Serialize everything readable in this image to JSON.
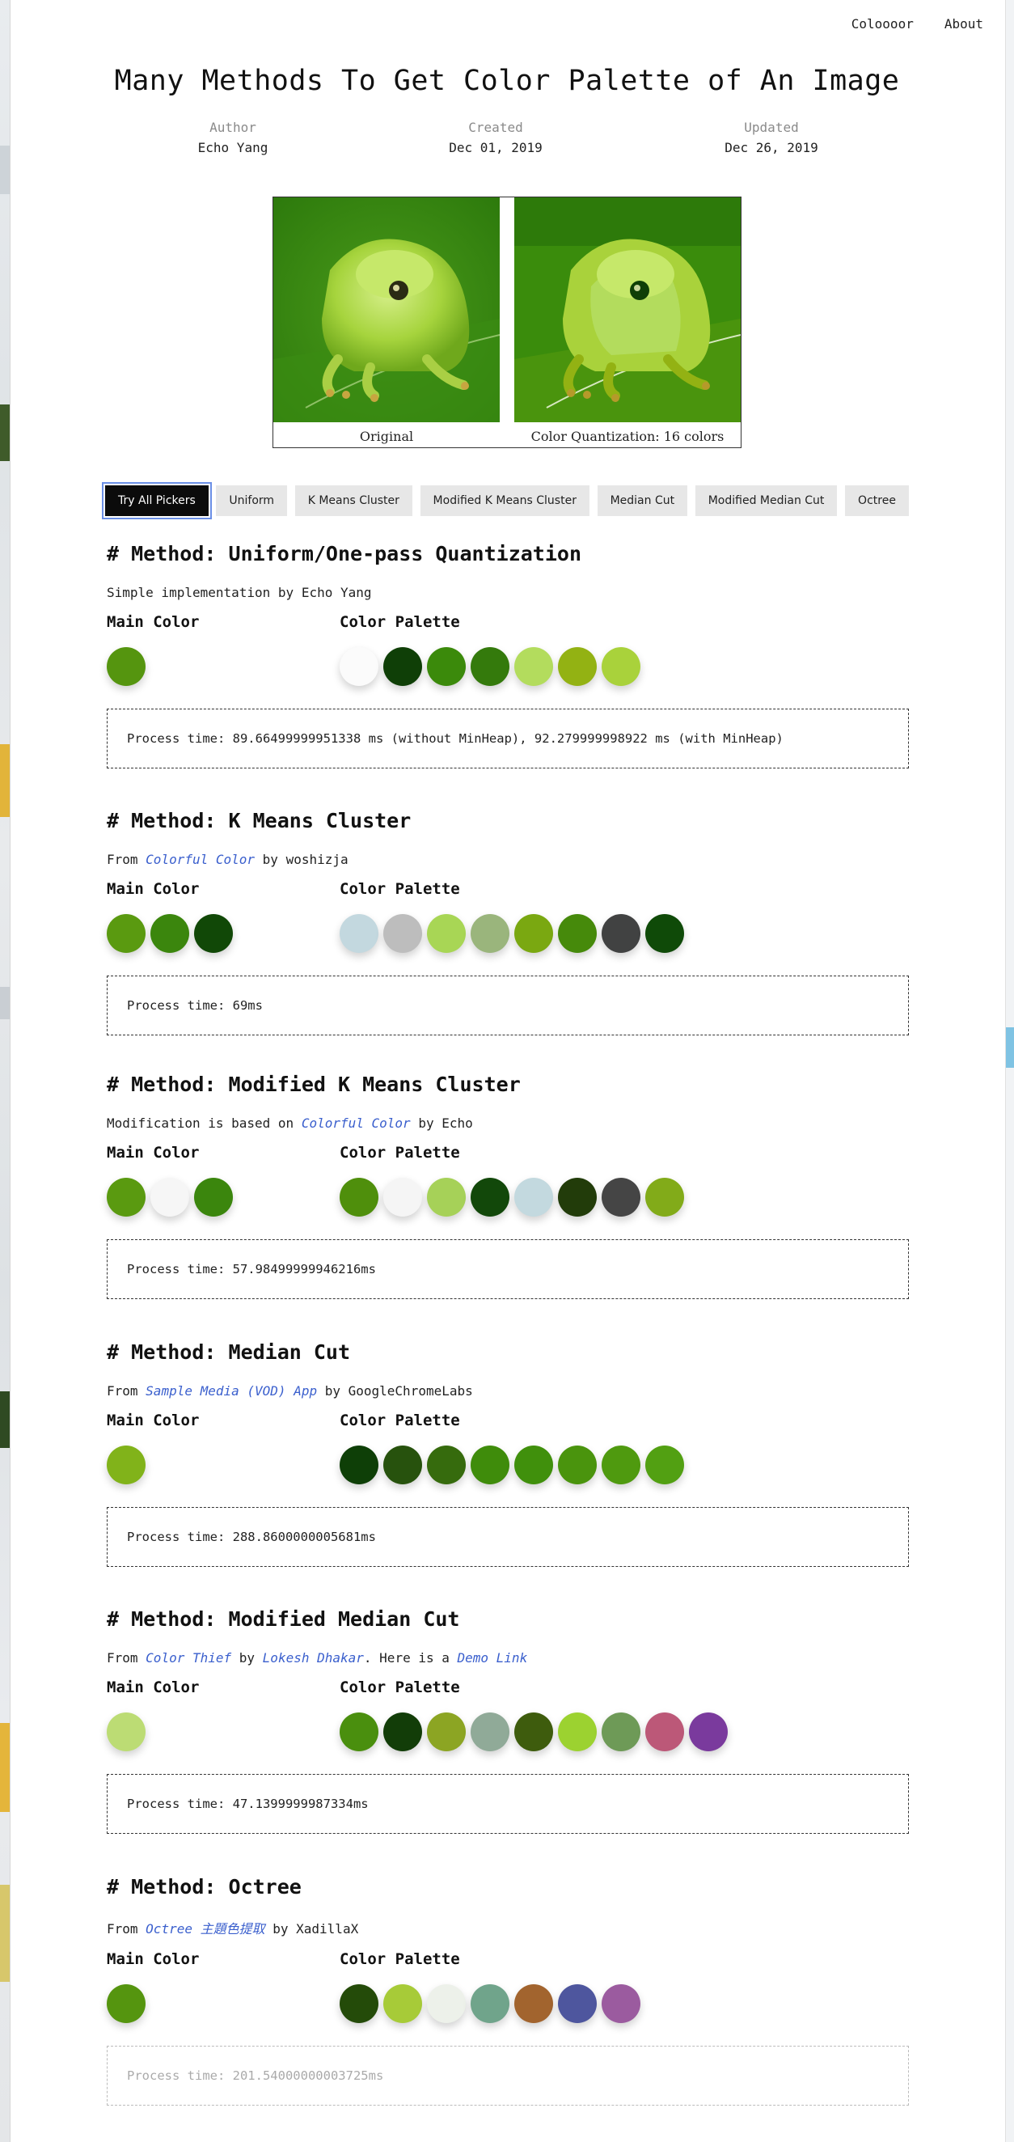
{
  "nav": {
    "links": [
      "Coloooor",
      "About"
    ]
  },
  "title": "Many Methods To Get Color Palette of An Image",
  "meta": [
    {
      "label": "Author",
      "value": "Echo Yang"
    },
    {
      "label": "Created",
      "value": "Dec 01, 2019"
    },
    {
      "label": "Updated",
      "value": "Dec 26, 2019"
    }
  ],
  "figure": {
    "captions": [
      "Original",
      "Color Quantization: 16 colors"
    ]
  },
  "tabs": [
    {
      "label": "Try All Pickers",
      "active": true
    },
    {
      "label": "Uniform"
    },
    {
      "label": "K Means Cluster"
    },
    {
      "label": "Modified K Means Cluster"
    },
    {
      "label": "Median Cut"
    },
    {
      "label": "Modified Median Cut"
    },
    {
      "label": "Octree"
    }
  ],
  "common": {
    "main_label": "Main Color",
    "palette_label": "Color Palette"
  },
  "sections": [
    {
      "title": "# Method: Uniform/One-pass Quantization",
      "desc": [
        {
          "text": "Simple implementation by Echo Yang"
        }
      ],
      "main": [
        "#55950f"
      ],
      "palette": [
        "#fbfbfb",
        "#0f3f07",
        "#3b8a0b",
        "#347a0c",
        "#b3dc5d",
        "#93b213",
        "#a9d23b"
      ],
      "process": "Process time: 89.66499999951338 ms (without MinHeap), 92.279999998922 ms (with MinHeap)"
    },
    {
      "title": "# Method: K Means Cluster",
      "desc": [
        {
          "text": "From "
        },
        {
          "text": "Colorful Color",
          "link": true
        },
        {
          "text": " by woshizja"
        }
      ],
      "main": [
        "#5a9a10",
        "#3b860d",
        "#114807"
      ],
      "palette": [
        "#c3d8df",
        "#bdbdbd",
        "#a8d655",
        "#9ab57c",
        "#7aa811",
        "#468a0b",
        "#414242",
        "#0f4a08"
      ],
      "process": "Process time: 69ms"
    },
    {
      "title": "# Method: Modified K Means Cluster",
      "desc": [
        {
          "text": "Modification is based on "
        },
        {
          "text": "Colorful Color",
          "link": true
        },
        {
          "text": " by Echo"
        }
      ],
      "main": [
        "#5a9a10",
        "#f6f6f6",
        "#3b860d"
      ],
      "palette": [
        "#4f8f0c",
        "#f5f5f5",
        "#a6d158",
        "#12480a",
        "#c3d9df",
        "#223c0a",
        "#454545",
        "#82ab19"
      ],
      "process": "Process time: 57.98499999946216ms"
    },
    {
      "title": "# Method: Median Cut",
      "desc": [
        {
          "text": "From "
        },
        {
          "text": "Sample Media (VOD) App",
          "link": true
        },
        {
          "text": " by GoogleChromeLabs"
        }
      ],
      "main": [
        "#81b31a"
      ],
      "palette": [
        "#0e3f07",
        "#27520d",
        "#366b0d",
        "#3f8c0b",
        "#40900c",
        "#4a940d",
        "#4f9a0f",
        "#52a012"
      ],
      "process": "Process time: 288.8600000005681ms"
    },
    {
      "title": "# Method: Modified Median Cut",
      "desc": [
        {
          "text": "From "
        },
        {
          "text": "Color Thief",
          "link": true
        },
        {
          "text": " by "
        },
        {
          "text": "Lokesh Dhakar",
          "link": true
        },
        {
          "text": ". Here is a "
        },
        {
          "text": "Demo Link",
          "link": true
        }
      ],
      "main": [
        "#bcdc74"
      ],
      "palette": [
        "#4a8f0e",
        "#123d08",
        "#8ca523",
        "#90aa98",
        "#3e5c0d",
        "#9cd230",
        "#6e9a57",
        "#bc5878",
        "#7a3a9d"
      ],
      "process": "Process time: 47.1399999987334ms"
    },
    {
      "title": "# Method: Octree",
      "desc": [
        {
          "text": "From "
        },
        {
          "text": "Octree 主題色提取",
          "link": true
        },
        {
          "text": " by XadillaX"
        }
      ],
      "main": [
        "#55950f"
      ],
      "palette": [
        "#244b09",
        "#a7cb38",
        "#edf1ea",
        "#70a48b",
        "#a2642e",
        "#4e569e",
        "#9b5b9f"
      ],
      "process": "Process time: 201.54000000003725ms",
      "faded": true
    }
  ]
}
